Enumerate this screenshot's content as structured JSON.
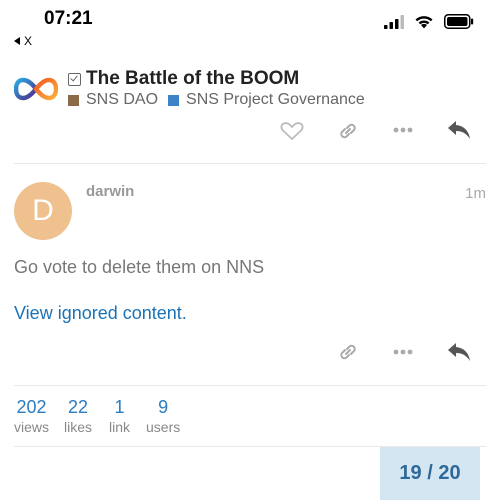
{
  "status_bar": {
    "time": "07:21",
    "back_label": "X",
    "icons": [
      "signal-icon",
      "wifi-icon",
      "battery-icon"
    ]
  },
  "topic": {
    "title": "The Battle of the BOOM",
    "categories": [
      {
        "label": "SNS DAO",
        "color": "#8b6a47"
      },
      {
        "label": "SNS Project Governance",
        "color": "#3c83c8"
      }
    ]
  },
  "post": {
    "avatar_letter": "D",
    "avatar_color": "#eec18f",
    "username": "darwin",
    "time_ago": "1m",
    "body": "Go vote to delete them on NNS",
    "ignored_link": "View ignored content."
  },
  "stats": [
    {
      "value": "202",
      "label": "views"
    },
    {
      "value": "22",
      "label": "likes"
    },
    {
      "value": "1",
      "label": "link"
    },
    {
      "value": "9",
      "label": "users"
    }
  ],
  "progress": {
    "text": "19 / 20"
  },
  "colors": {
    "link": "#1a73b8",
    "stat": "#2a7bc0",
    "progress_bg": "#d5e6f3",
    "progress_text": "#2e6a99"
  }
}
